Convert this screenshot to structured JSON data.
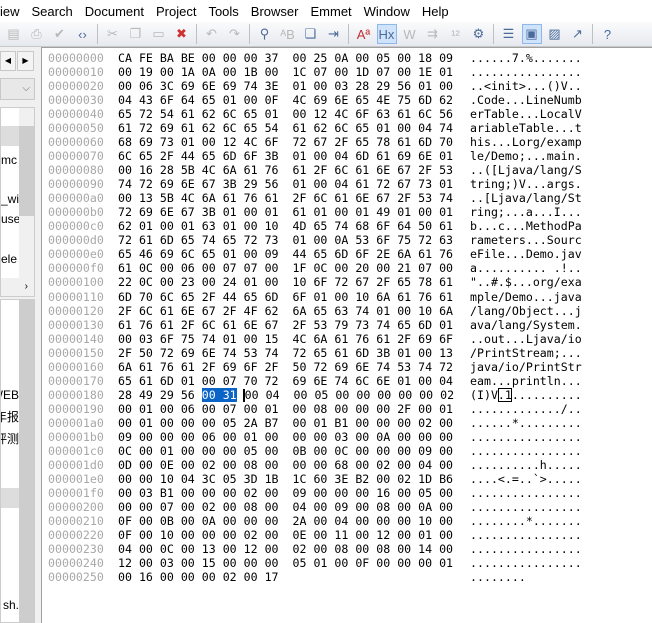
{
  "menu": [
    "iew",
    "Search",
    "Document",
    "Project",
    "Tools",
    "Browser",
    "Emmet",
    "Window",
    "Help"
  ],
  "toolbar_icons": [
    "print-preview-icon",
    "print-icon",
    "spellcheck-icon",
    "code-icon",
    "cut-icon",
    "copy-icon",
    "paste-icon",
    "delete-icon",
    "undo-icon",
    "redo-icon",
    "find-icon",
    "replace-icon",
    "find-in-files-icon",
    "goto-line-icon",
    "font-icon",
    "hex-mode-icon",
    "word-wrap-icon",
    "indent-icon",
    "line-numbers-icon",
    "settings-icon",
    "file-list-icon",
    "clip-panel-icon",
    "project-icon",
    "output-icon",
    "help-icon"
  ],
  "left_panel": {
    "items_top": [
      "mc",
      "_wi",
      "use",
      "ele"
    ],
    "items_bottom": [
      "WEB",
      "年报",
      "评测",
      ".sh"
    ]
  },
  "hex": {
    "selection": "00 31",
    "rows": [
      [
        "00000000",
        "CA FE BA BE 00 00 00 37  00 25 0A 00 05 00 18 09",
        "......7.%......."
      ],
      [
        "00000010",
        "00 19 00 1A 0A 00 1B 00  1C 07 00 1D 07 00 1E 01",
        "................"
      ],
      [
        "00000020",
        "00 06 3C 69 6E 69 74 3E  01 00 03 28 29 56 01 00",
        "..<init>...()V.."
      ],
      [
        "00000030",
        "04 43 6F 64 65 01 00 0F  4C 69 6E 65 4E 75 6D 62",
        ".Code...LineNumb"
      ],
      [
        "00000040",
        "65 72 54 61 62 6C 65 01  00 12 4C 6F 63 61 6C 56",
        "erTable...LocalV"
      ],
      [
        "00000050",
        "61 72 69 61 62 6C 65 54  61 62 6C 65 01 00 04 74",
        "ariableTable...t"
      ],
      [
        "00000060",
        "68 69 73 01 00 12 4C 6F  72 67 2F 65 78 61 6D 70",
        "his...Lorg/examp"
      ],
      [
        "00000070",
        "6C 65 2F 44 65 6D 6F 3B  01 00 04 6D 61 69 6E 01",
        "le/Demo;...main."
      ],
      [
        "00000080",
        "00 16 28 5B 4C 6A 61 76  61 2F 6C 61 6E 67 2F 53",
        "..([Ljava/lang/S"
      ],
      [
        "00000090",
        "74 72 69 6E 67 3B 29 56  01 00 04 61 72 67 73 01",
        "tring;)V...args."
      ],
      [
        "000000a0",
        "00 13 5B 4C 6A 61 76 61  2F 6C 61 6E 67 2F 53 74",
        "..[Ljava/lang/St"
      ],
      [
        "000000b0",
        "72 69 6E 67 3B 01 00 01  61 01 00 01 49 01 00 01",
        "ring;...a...I..."
      ],
      [
        "000000c0",
        "62 01 00 01 63 01 00 10  4D 65 74 68 6F 64 50 61",
        "b...c...MethodPa"
      ],
      [
        "000000d0",
        "72 61 6D 65 74 65 72 73  01 00 0A 53 6F 75 72 63",
        "rameters...Sourc"
      ],
      [
        "000000e0",
        "65 46 69 6C 65 01 00 09  44 65 6D 6F 2E 6A 61 76",
        "eFile...Demo.jav"
      ],
      [
        "000000f0",
        "61 0C 00 06 00 07 07 00  1F 0C 00 20 00 21 07 00",
        "a.......... .!.."
      ],
      [
        "00000100",
        "22 0C 00 23 00 24 01 00  10 6F 72 67 2F 65 78 61",
        "\"..#.$...org/exa"
      ],
      [
        "00000110",
        "6D 70 6C 65 2F 44 65 6D  6F 01 00 10 6A 61 76 61",
        "mple/Demo...java"
      ],
      [
        "00000120",
        "2F 6C 61 6E 67 2F 4F 62  6A 65 63 74 01 00 10 6A",
        "/lang/Object...j"
      ],
      [
        "00000130",
        "61 76 61 2F 6C 61 6E 67  2F 53 79 73 74 65 6D 01",
        "ava/lang/System."
      ],
      [
        "00000140",
        "00 03 6F 75 74 01 00 15  4C 6A 61 76 61 2F 69 6F",
        "..out...Ljava/io"
      ],
      [
        "00000150",
        "2F 50 72 69 6E 74 53 74  72 65 61 6D 3B 01 00 13",
        "/PrintStream;..."
      ],
      [
        "00000160",
        "6A 61 76 61 2F 69 6F 2F  50 72 69 6E 74 53 74 72",
        "java/io/PrintStr"
      ],
      [
        "00000170",
        "65 61 6D 01 00 07 70 72  69 6E 74 6C 6E 01 00 04",
        "eam...println..."
      ],
      [
        "00000180",
        "28 49 29 56 00 31 00 04  00 05 00 00 00 00 00 02",
        "(I)V.1.........."
      ],
      [
        "00000190",
        "00 01 00 06 00 07 00 01  00 08 00 00 00 2F 00 01",
        "............./.."
      ],
      [
        "000001a0",
        "00 01 00 00 00 05 2A B7  00 01 B1 00 00 00 02 00",
        "......*........."
      ],
      [
        "000001b0",
        "09 00 00 00 06 00 01 00  00 00 03 00 0A 00 00 00",
        "................"
      ],
      [
        "000001c0",
        "0C 00 01 00 00 00 05 00  0B 00 0C 00 00 00 09 00",
        "................"
      ],
      [
        "000001d0",
        "0D 00 0E 00 02 00 08 00  00 00 68 00 02 00 04 00",
        "..........h....."
      ],
      [
        "000001e0",
        "00 00 10 04 3C 05 3D 1B  1C 60 3E B2 00 02 1D B6",
        "....<.=..`>....."
      ],
      [
        "000001f0",
        "00 03 B1 00 00 00 02 00  09 00 00 00 16 00 05 00",
        "................"
      ],
      [
        "00000200",
        "00 00 07 00 02 00 08 00  04 00 09 00 08 00 0A 00",
        "................"
      ],
      [
        "00000210",
        "0F 00 0B 00 0A 00 00 00  2A 00 04 00 00 00 10 00",
        "........*......."
      ],
      [
        "00000220",
        "0F 00 10 00 00 00 02 00  0E 00 11 00 12 00 01 00",
        "................"
      ],
      [
        "00000230",
        "04 00 0C 00 13 00 12 00  02 00 08 00 08 00 14 00",
        "................"
      ],
      [
        "00000240",
        "12 00 03 00 15 00 00 00  05 01 00 0F 00 00 00 01",
        "................"
      ],
      [
        "00000250",
        "00 16 00 00 00 02 00 17",
        "........"
      ]
    ]
  }
}
